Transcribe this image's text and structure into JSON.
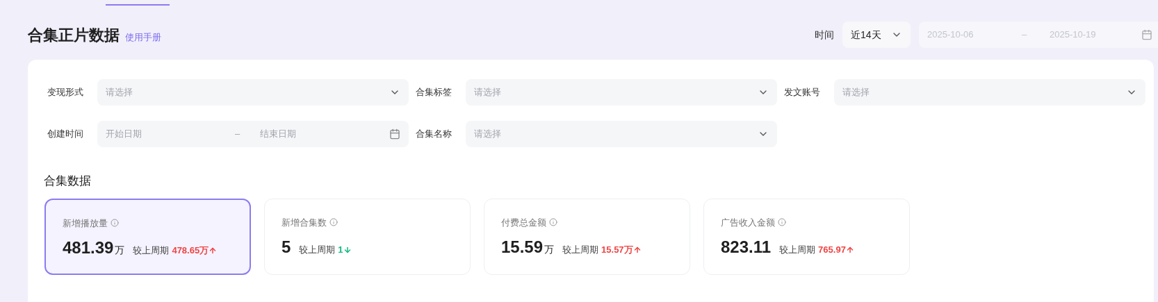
{
  "header": {
    "title": "合集正片数据",
    "manual_link": "使用手册",
    "time_label": "时间",
    "time_range": "近14天",
    "start_date": "2025-10-06",
    "date_separator": "–",
    "end_date": "2025-10-19"
  },
  "filters": [
    {
      "label": "变现形式",
      "kind": "select",
      "placeholder": "请选择"
    },
    {
      "label": "合集标签",
      "kind": "select",
      "placeholder": "请选择"
    },
    {
      "label": "发文账号",
      "kind": "select",
      "placeholder": "请选择"
    },
    {
      "label": "创建时间",
      "kind": "daterange",
      "start_placeholder": "开始日期",
      "separator": "–",
      "end_placeholder": "结束日期"
    },
    {
      "label": "合集名称",
      "kind": "select",
      "placeholder": "请选择"
    }
  ],
  "section_title": "合集数据",
  "metrics": [
    {
      "label": "新增播放量",
      "value": "481.39",
      "unit": "万",
      "compare_label": "较上周期",
      "compare_value": "478.65万",
      "kind": "up",
      "selected": true
    },
    {
      "label": "新增合集数",
      "value": "5",
      "compare_label": "较上周期",
      "compare_value": "1",
      "kind": "down",
      "selected": false
    },
    {
      "label": "付费总金额",
      "value": "15.59",
      "unit": "万",
      "compare_label": "较上周期",
      "compare_value": "15.57万",
      "kind": "up",
      "selected": false
    },
    {
      "label": "广告收入金额",
      "value": "823.11",
      "compare_label": "较上周期",
      "compare_value": "765.97",
      "kind": "up",
      "selected": false
    }
  ]
}
